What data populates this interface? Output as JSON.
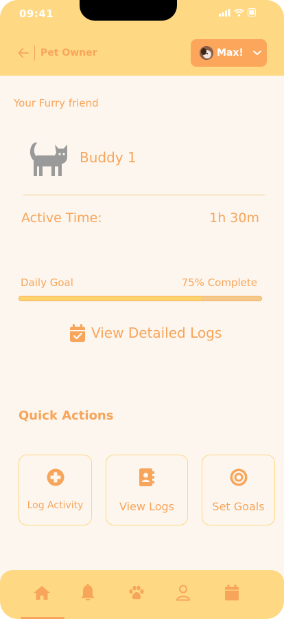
{
  "status_bar": {
    "time": "09:41"
  },
  "header": {
    "role_label": "Pet Owner",
    "user_name": "Max!",
    "icons": [
      "back-arrow-icon",
      "chevron-down-icon"
    ]
  },
  "pet": {
    "section_label": "Your Furry friend",
    "name": "Buddy 1",
    "icon": "cat-icon"
  },
  "activity": {
    "active_time_label": "Active Time:",
    "active_time_value": "1h 30m"
  },
  "goal": {
    "label": "Daily Goal",
    "status": "75% Complete",
    "progress": 0.75
  },
  "logs_link": {
    "label": "View Detailed Logs",
    "icon": "calendar-check-icon"
  },
  "quick_actions": {
    "title": "Quick Actions",
    "items": [
      {
        "label": "Log Activity",
        "icon": "plus-circle-icon"
      },
      {
        "label": "View Logs",
        "icon": "address-book-icon"
      },
      {
        "label": "Set Goals",
        "icon": "target-icon"
      }
    ]
  },
  "bottom_nav": {
    "items": [
      "home-icon",
      "bell-icon",
      "paw-icon",
      "user-icon",
      "calendar-icon"
    ],
    "active": "home-icon"
  },
  "colors": {
    "accent": "#f7a55a",
    "header_bg": "#ffd883",
    "page_bg": "#fcf6ef",
    "button_bg": "#fca65c"
  }
}
